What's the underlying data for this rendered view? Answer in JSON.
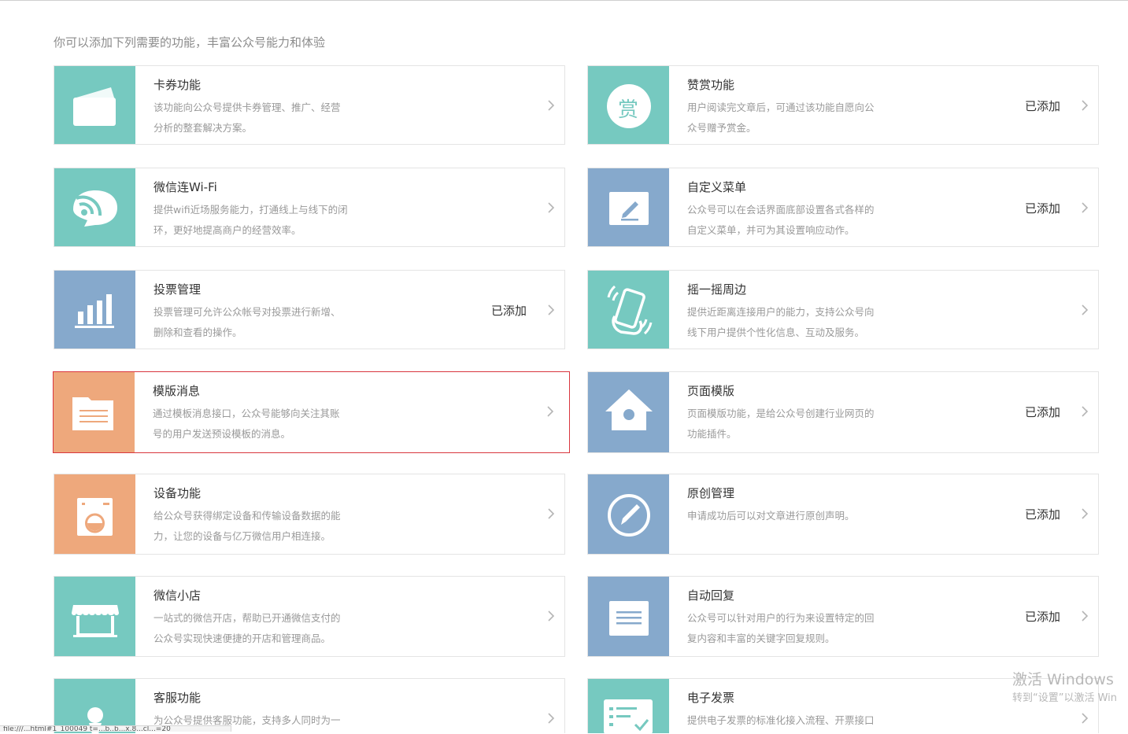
{
  "intro": "你可以添加下列需要的功能，丰富公众号能力和体验",
  "added_label": "已添加",
  "cards": [
    {
      "title": "卡券功能",
      "desc1": "该功能向公众号提供卡券管理、推广、经营",
      "desc2": "分析的整套解决方案。",
      "added": false,
      "icon": "card-icon",
      "color": "#76c9c0"
    },
    {
      "title": "赞赏功能",
      "desc1": "用户阅读完文章后，可通过该功能自愿向公",
      "desc2": "众号赠予赏金。",
      "added": true,
      "icon": "reward-icon",
      "icon_char": "赏",
      "color": "#76c9c0"
    },
    {
      "title": "微信连Wi-Fi",
      "desc1": "提供wifi近场服务能力，打通线上与线下的闭",
      "desc2": "环，更好地提高商户的经营效率。",
      "added": false,
      "icon": "wifi-icon",
      "color": "#76c9c0"
    },
    {
      "title": "自定义菜单",
      "desc1": "公众号可以在会话界面底部设置各式各样的",
      "desc2": "自定义菜单，并可为其设置响应动作。",
      "added": true,
      "icon": "edit-menu-icon",
      "color": "#86a9cc"
    },
    {
      "title": "投票管理",
      "desc1": "投票管理可允许公众帐号对投票进行新增、",
      "desc2": "删除和查看的操作。",
      "added": true,
      "icon": "bar-chart-icon",
      "color": "#86a9cc"
    },
    {
      "title": "摇一摇周边",
      "desc1": "提供近距离连接用户的能力，支持公众号向",
      "desc2": "线下用户提供个性化信息、互动及服务。",
      "added": false,
      "icon": "shake-phone-icon",
      "color": "#76c9c0"
    },
    {
      "title": "模版消息",
      "desc1": "通过模板消息接口，公众号能够向关注其账",
      "desc2": "号的用户发送预设模板的消息。",
      "added": false,
      "icon": "template-doc-icon",
      "color": "#eea87c"
    },
    {
      "title": "页面模版",
      "desc1": "页面模版功能，是给公众号创建行业网页的",
      "desc2": "功能插件。",
      "added": true,
      "icon": "home-icon",
      "color": "#86a9cc"
    },
    {
      "title": "设备功能",
      "desc1": "给公众号获得绑定设备和传输设备数据的能",
      "desc2": "力，让您的设备与亿万微信用户相连接。",
      "added": false,
      "icon": "washer-device-icon",
      "color": "#eea87c"
    },
    {
      "title": "原创管理",
      "desc1": "申请成功后可以对文章进行原创声明。",
      "desc2": "",
      "added": true,
      "icon": "original-pen-icon",
      "color": "#86a9cc"
    },
    {
      "title": "微信小店",
      "desc1": "一站式的微信开店，帮助已开通微信支付的",
      "desc2": "公众号实现快速便捷的开店和管理商品。",
      "added": false,
      "icon": "shop-icon",
      "color": "#76c9c0"
    },
    {
      "title": "自动回复",
      "desc1": "公众号可以针对用户的行为来设置特定的回",
      "desc2": "复内容和丰富的关键字回复规则。",
      "added": true,
      "icon": "auto-reply-icon",
      "color": "#86a9cc"
    },
    {
      "title": "客服功能",
      "desc1": "为公众号提供客服功能，支持多人同时为一",
      "desc2": "",
      "added": false,
      "icon": "customer-service-icon",
      "color": "#76c9c0"
    },
    {
      "title": "电子发票",
      "desc1": "提供电子发票的标准化接入流程、开票接口",
      "desc2": "",
      "added": false,
      "icon": "invoice-icon",
      "color": "#76c9c0"
    }
  ],
  "watermark": {
    "line1": "激活 Windows",
    "line2": "转到“设置”以激活 Win"
  },
  "statusbar": "file:///...html#1_100049   t=...b..b...x.8...cl...=20"
}
